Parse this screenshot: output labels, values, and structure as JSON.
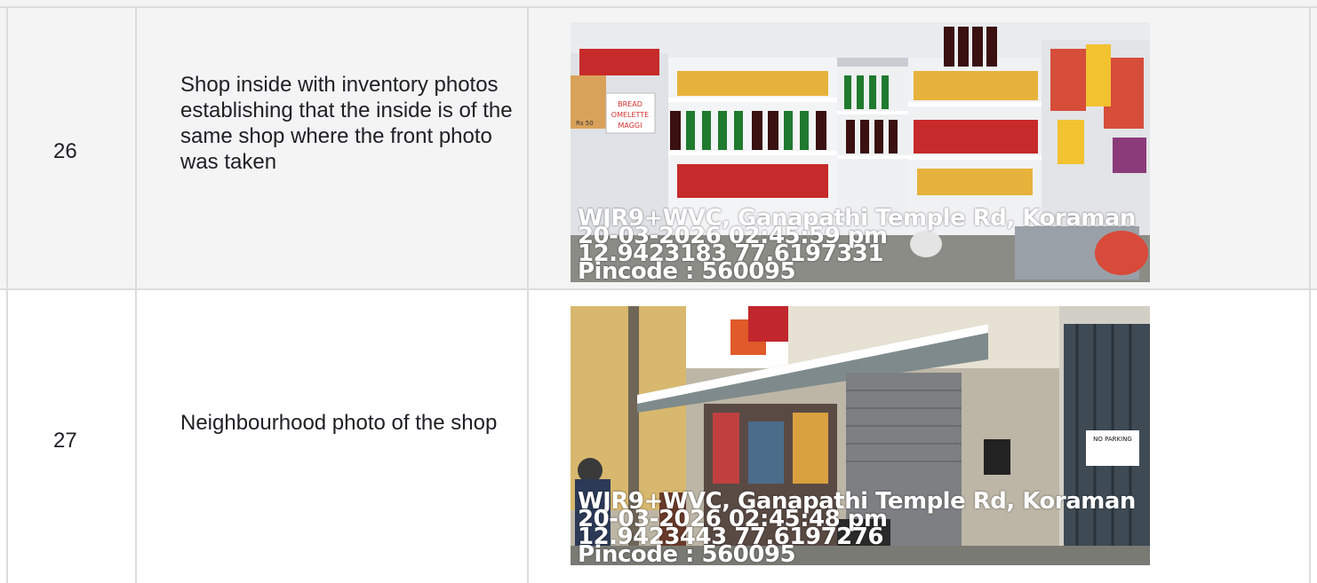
{
  "rows": [
    {
      "number": "26",
      "description": "Shop inside with inventory photos establishing that the inside is of the same shop where the front photo was taken",
      "photo": {
        "subject": "shop-interior",
        "stamp": [
          "WJR9+WVC, Ganapathi Temple Rd, Koraman",
          "20-03-2026 02:45:59 pm",
          "12.9423183 77.6197331",
          "Pincode : 560095"
        ],
        "shelf_signs": [
          "BREAD",
          "OMELETTE",
          "MAGGI",
          "Rs 50"
        ]
      }
    },
    {
      "number": "27",
      "description": "Neighbourhood photo of the shop",
      "photo": {
        "subject": "shop-street-view",
        "stamp": [
          "WJR9+WVC, Ganapathi Temple Rd, Koraman",
          "20-03-2026 02:45:48 pm",
          "12.9423443 77.6197276",
          "Pincode : 560095"
        ],
        "wall_sign": "NO PARKING"
      }
    }
  ],
  "colors": {
    "row_alt_bg": "#f4f4f4",
    "grid_line": "#dcdcdc"
  }
}
